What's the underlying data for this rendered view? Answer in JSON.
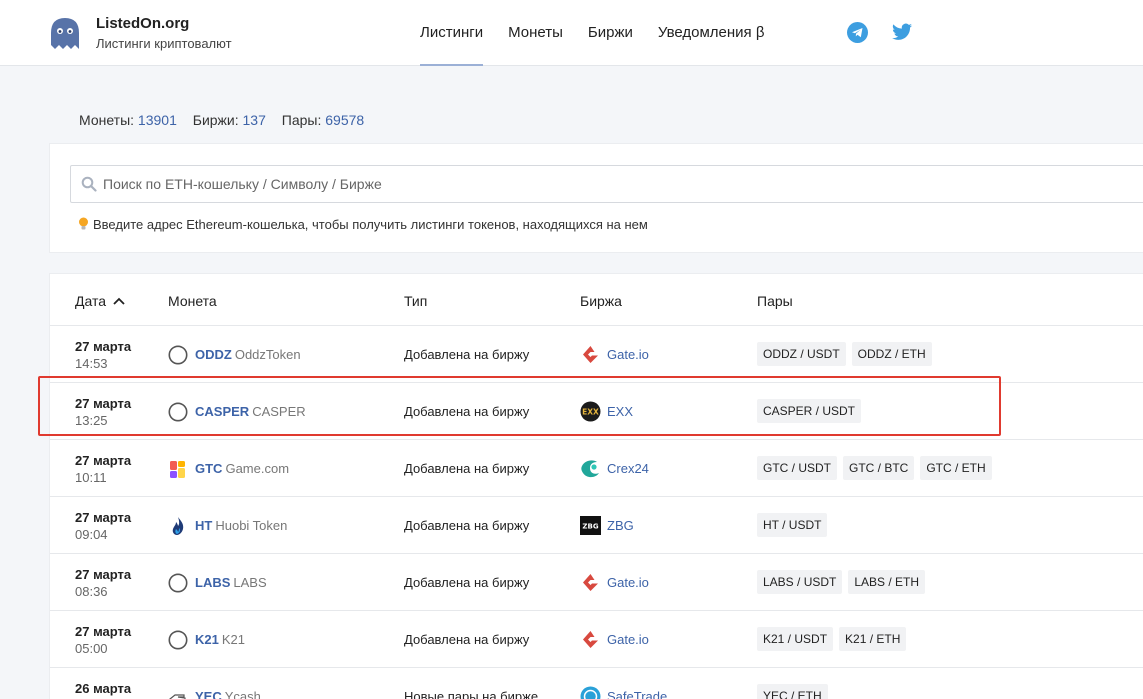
{
  "brand": {
    "name": "ListedOn.org",
    "subtitle": "Листинги криптовалют"
  },
  "nav": [
    "Листинги",
    "Монеты",
    "Биржи",
    "Уведомления β"
  ],
  "social": [
    "telegram-icon",
    "twitter-icon"
  ],
  "stats": {
    "coins_label": "Монеты:",
    "coins": "13901",
    "exchanges_label": "Биржи:",
    "exchanges": "137",
    "pairs_label": "Пары:",
    "pairs": "69578"
  },
  "search": {
    "placeholder": "Поиск по ETH-кошельку / Символу / Бирже",
    "hint": "Введите адрес Ethereum-кошелька, чтобы получить листинги токенов, находящихся на нем"
  },
  "table": {
    "headers": {
      "date": "Дата",
      "coin": "Монета",
      "type": "Тип",
      "exchange": "Биржа",
      "pairs": "Пары"
    },
    "rows": [
      {
        "date": "27 марта",
        "time": "14:53",
        "symbol": "ODDZ",
        "name": "OddzToken",
        "coin_icon": "circle-icon",
        "type": "Добавлена на биржу",
        "exchange": "Gate.io",
        "exchange_icon": "gateio-icon",
        "pairs": [
          "ODDZ / USDT",
          "ODDZ / ETH"
        ]
      },
      {
        "date": "27 марта",
        "time": "13:25",
        "symbol": "CASPER",
        "name": "CASPER",
        "coin_icon": "circle-icon",
        "type": "Добавлена на биржу",
        "exchange": "EXX",
        "exchange_icon": "exx-icon",
        "pairs": [
          "CASPER / USDT"
        ]
      },
      {
        "date": "27 марта",
        "time": "10:11",
        "symbol": "GTC",
        "name": "Game.com",
        "coin_icon": "gamecom-icon",
        "type": "Добавлена на биржу",
        "exchange": "Crex24",
        "exchange_icon": "crex24-icon",
        "pairs": [
          "GTC / USDT",
          "GTC / BTC",
          "GTC / ETH"
        ]
      },
      {
        "date": "27 марта",
        "time": "09:04",
        "symbol": "HT",
        "name": "Huobi Token",
        "coin_icon": "huobi-flame-icon",
        "type": "Добавлена на биржу",
        "exchange": "ZBG",
        "exchange_icon": "zbg-icon",
        "pairs": [
          "HT / USDT"
        ]
      },
      {
        "date": "27 марта",
        "time": "08:36",
        "symbol": "LABS",
        "name": "LABS",
        "coin_icon": "circle-icon",
        "type": "Добавлена на биржу",
        "exchange": "Gate.io",
        "exchange_icon": "gateio-icon",
        "pairs": [
          "LABS / USDT",
          "LABS / ETH"
        ]
      },
      {
        "date": "27 марта",
        "time": "05:00",
        "symbol": "K21",
        "name": "K21",
        "coin_icon": "circle-icon",
        "type": "Добавлена на биржу",
        "exchange": "Gate.io",
        "exchange_icon": "gateio-icon",
        "pairs": [
          "K21 / USDT",
          "K21 / ETH"
        ]
      },
      {
        "date": "26 марта",
        "time": "",
        "symbol": "YEC",
        "name": "Ycash",
        "coin_icon": "ycash-hand-icon",
        "type": "Новые пары на бирже",
        "exchange": "SafeTrade",
        "exchange_icon": "safetrade-icon",
        "pairs": [
          "YEC / ETH"
        ]
      }
    ]
  },
  "colors": {
    "accent": "#3d63a8",
    "highlight": "#e03a2f"
  }
}
